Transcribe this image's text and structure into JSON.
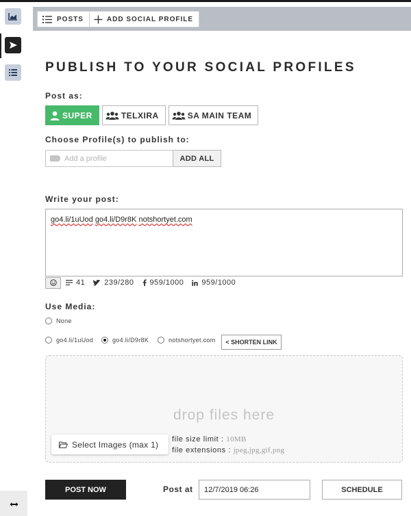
{
  "topbar": {
    "tabs": [
      {
        "label": "POSTS",
        "icon": "list-icon"
      },
      {
        "label": "ADD SOCIAL PROFILE",
        "icon": "plus-icon"
      }
    ]
  },
  "sidebar": {
    "items": [
      {
        "icon": "chart-icon"
      },
      {
        "icon": "send-icon",
        "active": true
      },
      {
        "icon": "list-icon"
      }
    ],
    "bottom_icon": "expand-horizontal-icon"
  },
  "page": {
    "title": "PUBLISH TO YOUR SOCIAL PROFILES"
  },
  "post_as": {
    "label": "Post as:",
    "options": [
      {
        "label": "SUPER",
        "icon": "user-icon",
        "selected": true
      },
      {
        "label": "TELXIRA",
        "icon": "team-icon",
        "selected": false
      },
      {
        "label": "SA MAIN TEAM",
        "icon": "team-icon",
        "selected": false
      }
    ]
  },
  "profiles": {
    "label": "Choose Profile(s) to publish to:",
    "placeholder": "Add a profile",
    "add_all_label": "ADD ALL"
  },
  "post": {
    "label": "Write your post:",
    "links": [
      "go4.li/1uUod",
      "go4.li/D9r8K",
      "notshortyet.com"
    ],
    "counters": {
      "emoji_icon": "smiley-icon",
      "chars": "41",
      "twitter": "239/280",
      "facebook": "959/1000",
      "linkedin": "959/1000"
    }
  },
  "media": {
    "label": "Use Media:",
    "none_label": "None",
    "options": [
      {
        "label": "go4.li/1uUod",
        "selected": false
      },
      {
        "label": "go4.li/D9r8K",
        "selected": true
      },
      {
        "label": "notshortyet.com",
        "selected": false
      }
    ],
    "shorten_label": "< SHORTEN LINK"
  },
  "dropzone": {
    "text": "drop files here",
    "select_label": "Select Images (max 1)",
    "size_label": "file size limit :",
    "size_value": "10MB",
    "ext_label": "file extensions :",
    "ext_value": "jpeg,jpg,gif,png"
  },
  "actions": {
    "post_now": "POST NOW",
    "post_at_label": "Post at",
    "date_value": "12/7/2019 06:26",
    "schedule": "SCHEDULE"
  },
  "colors": {
    "accent_green": "#47b96a",
    "topbar_gray": "#b9bec4",
    "dark": "#222222",
    "rail_icon_bg": "#c6cfdb"
  }
}
